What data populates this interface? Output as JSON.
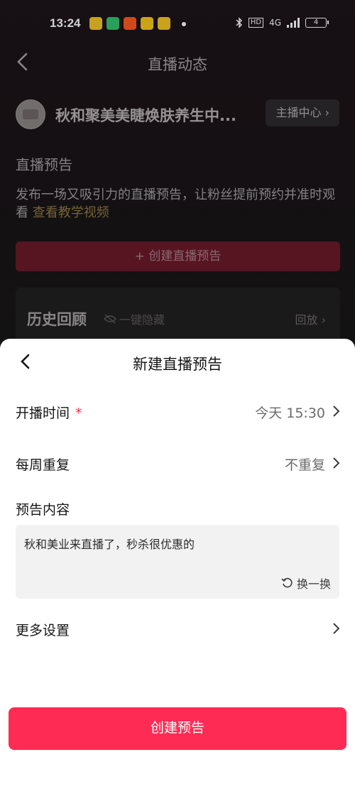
{
  "status_bar": {
    "time": "13:24",
    "app_icon_colors": [
      "#f4c528",
      "#33c46d",
      "#ff5a1f",
      "#f7c81e",
      "#f4c528"
    ],
    "hd_badge": "HD",
    "network": "4G",
    "battery_level": "4"
  },
  "background_page": {
    "title": "直播动态",
    "anchor_name": "秋和聚美美睫焕肤养生中...",
    "anchor_center_label": "主播中心",
    "section_title": "直播预告",
    "description": "发布一场又吸引力的直播预告，让粉丝提前预约并准时观看",
    "tutorial_link": "查看教学视频",
    "create_banner_label": "+ 创建直播预告",
    "history_title": "历史回顾",
    "hide_toggle_label": "一键隐藏",
    "playback_label": "回放"
  },
  "sheet": {
    "title": "新建直播预告",
    "start_time": {
      "label": "开播时间",
      "required_mark": "*",
      "value": "今天 15:30"
    },
    "repeat": {
      "label": "每周重复",
      "value": "不重复"
    },
    "content_label": "预告内容",
    "content_text": "秋和美业来直播了，秒杀很优惠的",
    "swap_label": "换一换",
    "more_settings_label": "更多设置",
    "submit_label": "创建预告"
  },
  "colors": {
    "accent": "#fe2c55",
    "link_gold": "#8f7a45",
    "required_star": "#e8344d"
  }
}
